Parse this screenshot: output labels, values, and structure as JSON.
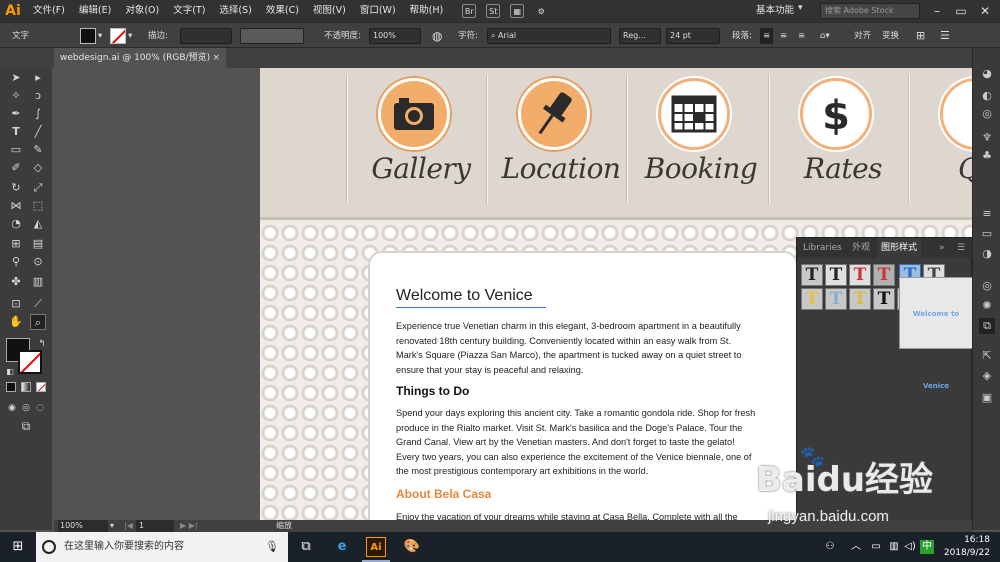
{
  "menubar": {
    "logo": "Ai",
    "items": [
      "文件(F)",
      "编辑(E)",
      "对象(O)",
      "文字(T)",
      "选择(S)",
      "效果(C)",
      "视图(V)",
      "窗口(W)",
      "帮助(H)"
    ],
    "workspace": "基本功能",
    "stock_search_placeholder": "搜索 Adobe Stock"
  },
  "controlbar": {
    "context": "文字",
    "stroke_label": "描边:",
    "opacity_label": "不透明度:",
    "opacity_value": "100%",
    "char_label": "字符:",
    "font_name": "Arial",
    "font_style": "Reg...",
    "font_size": "24 pt",
    "para_label": "段落:",
    "align_label": "对齐",
    "transform_label": "变换"
  },
  "document_tab": {
    "title": "webdesign.ai @ 100% (RGB/预览)",
    "close": "×"
  },
  "website": {
    "nav": [
      {
        "label": "Gallery",
        "icon": "camera-icon"
      },
      {
        "label": "Location",
        "icon": "pushpin-icon"
      },
      {
        "label": "Booking",
        "icon": "calendar-icon"
      },
      {
        "label": "Rates",
        "icon": "dollar-icon"
      },
      {
        "label": "Qu",
        "icon": "question-icon"
      }
    ],
    "welcome_title": "Welcome to Venice",
    "intro": "Experience true Venetian charm in this elegant, 3-bedroom apartment in a beautifully renovated 18th century building. Conveniently located within an easy walk from St. Mark's Square (Piazza San Marco), the apartment is tucked away on a quiet street to ensure that your stay is peaceful and relaxing.",
    "things_title": "Things to Do",
    "things_text": "Spend your days exploring this ancient city. Take a romantic gondola ride. Shop for fresh produce in the Rialto market. Visit St. Mark's basilica and the Doge's Palace. Tour the Grand Canal. View art by the Venetian masters. And don't forget to taste the gelato! Every two years, you can also experience the excitement of the Venice biennale, one of the most prestigious contemporary art exhibitions in the world.",
    "about_title": "About Bela Casa",
    "about_text": "Enjoy the vacation of your dreams while staying at Casa Bella. Complete with all the"
  },
  "graphic_styles_panel": {
    "tabs": [
      "Libraries",
      "外观",
      "图形样式"
    ],
    "more": "»",
    "preview_text": "Welcome to Venice",
    "swatch_glyph": "T"
  },
  "statusbar": {
    "zoom": "100%",
    "page": "1",
    "info": "缩放"
  },
  "taskbar": {
    "search_placeholder": "在这里输入你要搜索的内容",
    "time": "16:18",
    "date": "2018/9/22",
    "ime": "中"
  },
  "watermark": {
    "brand": "Baidu经验",
    "url": "jingyan.baidu.com"
  },
  "colors": {
    "accent_orange": "#e8873a",
    "ai_orange": "#ff9a00",
    "badge_orange": "#f3ad6a"
  }
}
